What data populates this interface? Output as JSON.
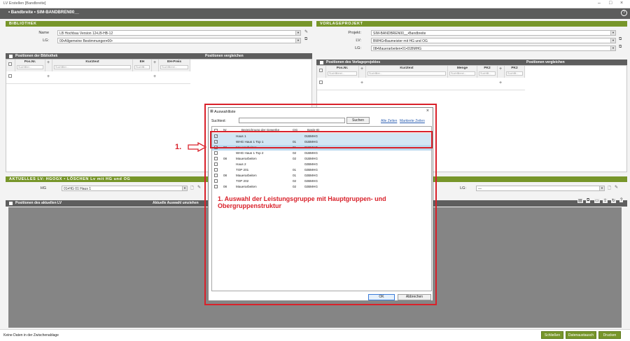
{
  "window": {
    "title": "LV Erstellen [Bandbreite]",
    "controls": [
      "–",
      "□",
      "×"
    ]
  },
  "header": {
    "title": "• Bandbreite • SIM-BANDBREN00__"
  },
  "bibliothek": {
    "title": "BIBLIOTHEK",
    "name_label": "Name",
    "name_value": "LB Hochbau Version 12•LB-HB-12",
    "lg_label": "LG:",
    "lg_value": "00•Allgemeine Bestimmungen•00•",
    "positions_header": "Positionen der Bibliothek",
    "compare_header": "Positionen vergleichen",
    "columns": [
      {
        "label": "Pos.Nr.",
        "filter": "Suchfilter..."
      },
      {
        "label": "Kurztext",
        "filter": "Suchfilter..."
      },
      {
        "label": "EH",
        "filter": "Suchfilt..."
      },
      {
        "label": "EH-Preis",
        "filter": "Suchfilterei..."
      }
    ]
  },
  "vorlageprojekt": {
    "title": "VORLAGEPROJEKT",
    "projekt_label": "Projekt:",
    "projekt_value": "SIM-BANDBREN00__•Bandbreite",
    "lv_label": "LV:",
    "lv_value": "BMHG•Baumeister mit HG und OG",
    "lg_label": "LG:",
    "lg_value": "08•Mauerarbeiten•01•01BMHG",
    "positions_header": "Positionen des Vorlageprojektes",
    "compare_header": "Positionen vergleichen",
    "columns": [
      {
        "label": "Pos.Nr.",
        "filter": "Suchfilterei..."
      },
      {
        "label": "Kurztext",
        "filter": "Suchfilter..."
      },
      {
        "label": "Menge",
        "filter": "Suchfilterei..."
      },
      {
        "label": "PK2",
        "filter": "Suchfilt..."
      },
      {
        "label": "PK2",
        "filter": "Suchfilt..."
      }
    ]
  },
  "aktuelles_lv": {
    "title": "AKTUELLES LV: HGOGX • LÖSCHEN Lv mit HG und OG",
    "hg_label": "HG",
    "hg_value": "01•HG 01 Haus 1",
    "lg_label": "LG:",
    "lg_value": "—",
    "positions_header": "Positionen des aktuellen LV",
    "selection_header": "Aktuelle Auswahl umziehen"
  },
  "dialog": {
    "title": "Auswahlliste",
    "search_label": "Suchtext:",
    "search_value": "",
    "search_button": "Suchen",
    "link_all": "Alle Zeilen",
    "link_marked": "Markierte Zeilen",
    "columns": {
      "nr": "Nr",
      "bezeichnung": "Bezeichnung der Gewerke",
      "og": "OG",
      "basis": "Basis-ID"
    },
    "rows": [
      {
        "checked": true,
        "nr": "",
        "bez": "Haus 1",
        "og": "",
        "basis": "01BMHG"
      },
      {
        "checked": true,
        "nr": "",
        "bez": "WHG Haus 1 Top 1",
        "og": "01",
        "basis": "01BMHG"
      },
      {
        "checked": true,
        "nr": "08",
        "bez": "Mauerarbeiten",
        "og": "01",
        "basis": "01BMHG"
      },
      {
        "checked": false,
        "nr": "",
        "bez": "WHG Haus 1 Top 2",
        "og": "02",
        "basis": "01BMHG"
      },
      {
        "checked": false,
        "nr": "08",
        "bez": "Mauerarbeiten",
        "og": "02",
        "basis": "01BMHG"
      },
      {
        "checked": false,
        "nr": "",
        "bez": "Haus 2",
        "og": "",
        "basis": "02BMHG"
      },
      {
        "checked": false,
        "nr": "",
        "bez": "TOP 201",
        "og": "01",
        "basis": "02BMHG"
      },
      {
        "checked": false,
        "nr": "08",
        "bez": "Mauerarbeiten",
        "og": "01",
        "basis": "02BMHG"
      },
      {
        "checked": false,
        "nr": "",
        "bez": "TOP 202",
        "og": "02",
        "basis": "02BMHG"
      },
      {
        "checked": false,
        "nr": "08",
        "bez": "Mauerarbeiten",
        "og": "02",
        "basis": "02BMHG"
      }
    ],
    "ok_button": "OK",
    "cancel_button": "Abbrechen"
  },
  "annotation": {
    "marker": "1.",
    "text_line1": "1. Auswahl der Leistungsgruppe mit Hauptgruppen- und",
    "text_line2": "Obergruppenstruktur"
  },
  "statusbar": {
    "text": "Keine Daten in der Zwischenablage",
    "buttons": [
      "Schließen",
      "Datenaustausch",
      "Drucken"
    ]
  },
  "colors": {
    "accent_green": "#77962a",
    "annotation_red": "#d9212a",
    "header_dark": "#5c5c5c"
  }
}
